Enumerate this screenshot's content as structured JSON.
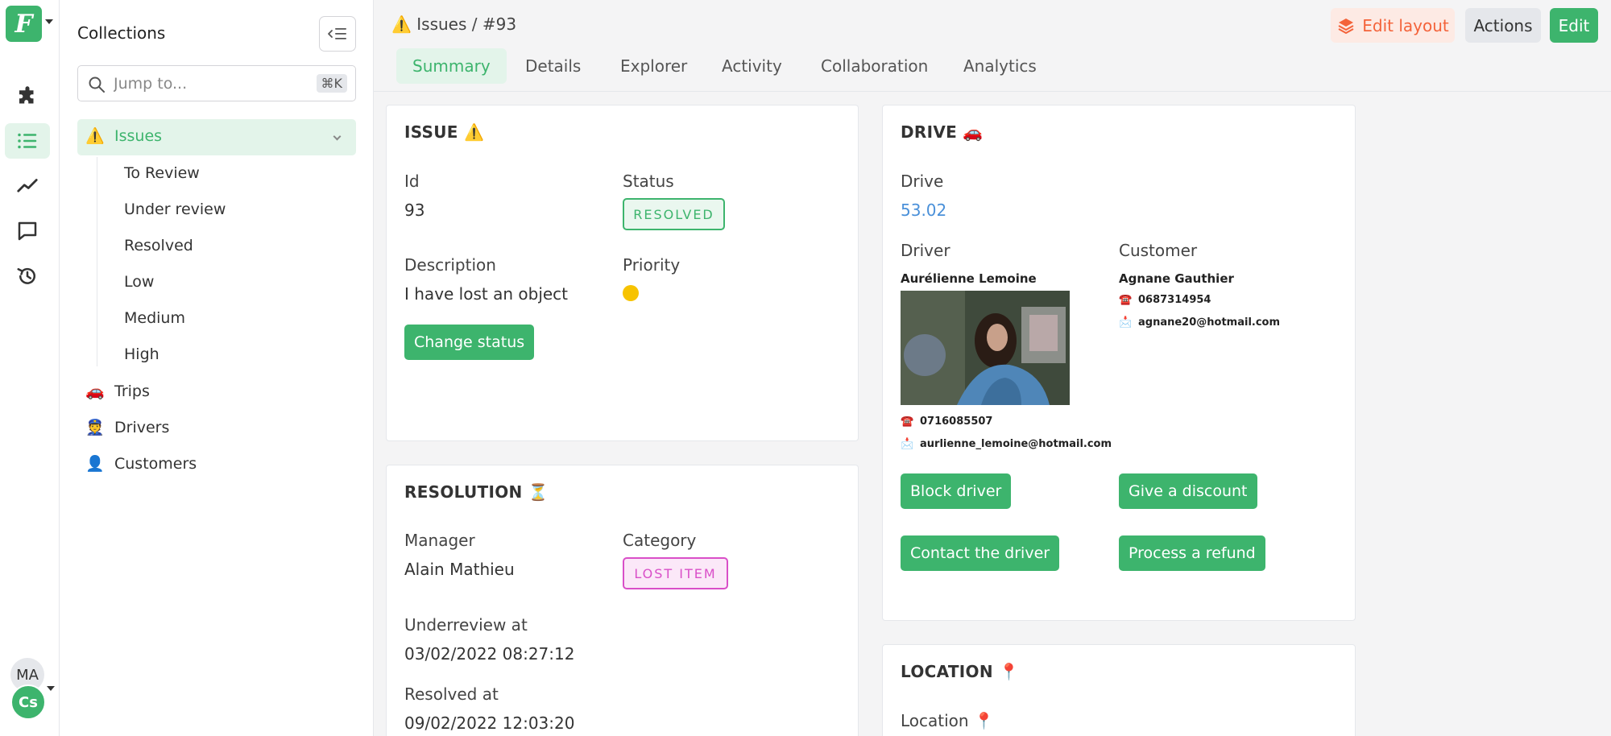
{
  "app": {
    "logo_letter": "F",
    "user_initials": "MA",
    "workspace_initials": "Cs"
  },
  "rail": {
    "icons": [
      "puzzle-icon",
      "list-icon",
      "trend-icon",
      "chat-icon",
      "history-icon"
    ]
  },
  "sidebar": {
    "title": "Collections",
    "search_placeholder": "Jump to...",
    "search_shortcut": "⌘K",
    "issues": {
      "emoji": "⚠️",
      "label": "Issues"
    },
    "issue_views": [
      "To Review",
      "Under review",
      "Resolved",
      "Low",
      "Medium",
      "High"
    ],
    "collections": [
      {
        "emoji": "🚗",
        "label": "Trips"
      },
      {
        "emoji": "👮",
        "label": "Drivers"
      },
      {
        "emoji": "👤",
        "label": "Customers"
      }
    ]
  },
  "header": {
    "breadcrumb_emoji": "⚠️",
    "breadcrumb_collection": "Issues",
    "breadcrumb_separator": "/",
    "breadcrumb_record": "#93",
    "edit_layout_label": "Edit layout",
    "actions_label": "Actions",
    "edit_label": "Edit"
  },
  "tabs": [
    "Summary",
    "Details",
    "Explorer",
    "Activity",
    "Collaboration",
    "Analytics"
  ],
  "active_tab": "Summary",
  "issue_card": {
    "title": "ISSUE ⚠️",
    "id_label": "Id",
    "id_value": "93",
    "status_label": "Status",
    "status_value": "RESOLVED",
    "description_label": "Description",
    "description_value": "I have lost an object",
    "priority_label": "Priority",
    "priority_color": "#f7c300",
    "change_status_label": "Change status"
  },
  "resolution_card": {
    "title": "RESOLUTION ⏳",
    "manager_label": "Manager",
    "manager_value": "Alain Mathieu",
    "category_label": "Category",
    "category_value": "LOST ITEM",
    "underreview_label": "Underreview at",
    "underreview_value": "03/02/2022 08:27:12",
    "resolved_label": "Resolved at",
    "resolved_value": "09/02/2022 12:03:20"
  },
  "drive_card": {
    "title": "DRIVE 🚗",
    "drive_label": "Drive",
    "drive_value": "53.02",
    "driver_label": "Driver",
    "driver_name": "Aurélienne Lemoine",
    "driver_phone": "0716085507",
    "driver_email": "aurlienne_lemoine@hotmail.com",
    "customer_label": "Customer",
    "customer_name": "Agnane Gauthier",
    "customer_phone": "0687314954",
    "customer_email": "agnane20@hotmail.com",
    "phone_icon": "☎️",
    "email_icon": "📩",
    "block_driver_label": "Block driver",
    "give_discount_label": "Give a discount",
    "contact_driver_label": "Contact the driver",
    "process_refund_label": "Process a refund"
  },
  "location_card": {
    "title": "LOCATION 📍",
    "location_label": "Location 📍"
  },
  "colors": {
    "brand_green": "#3db46d",
    "edit_layout_orange": "#f4633a",
    "link_blue": "#4a90d9",
    "category_pink": "#d94fc8"
  }
}
